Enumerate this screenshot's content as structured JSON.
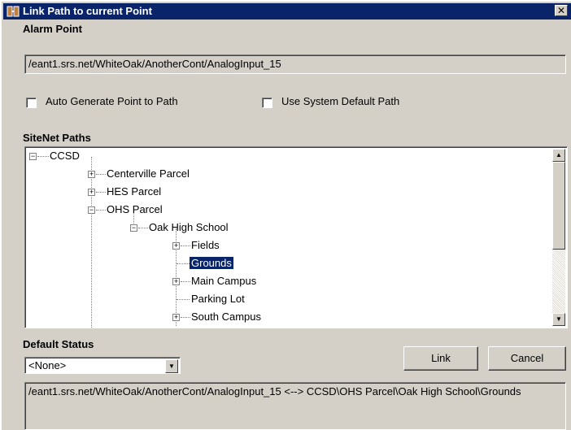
{
  "window": {
    "title": "Link Path to current Point",
    "close_glyph": "✕"
  },
  "alarm_point": {
    "label": "Alarm Point",
    "value": "/eant1.srs.net/WhiteOak/AnotherCont/AnalogInput_15"
  },
  "options": {
    "auto_generate": {
      "label": "Auto Generate Point to Path",
      "checked": false
    },
    "use_default": {
      "label": "Use System Default Path",
      "checked": false
    }
  },
  "sitenet": {
    "label": "SiteNet Paths",
    "nodes": [
      {
        "label": "CCSD",
        "expander": "−"
      },
      {
        "label": "Centerville Parcel",
        "expander": "+"
      },
      {
        "label": "HES Parcel",
        "expander": "+"
      },
      {
        "label": "OHS Parcel",
        "expander": "−"
      },
      {
        "label": "Oak High School",
        "expander": "−"
      },
      {
        "label": "Fields",
        "expander": "+"
      },
      {
        "label": "Grounds",
        "expander": "",
        "selected": true
      },
      {
        "label": "Main Campus",
        "expander": "+"
      },
      {
        "label": "Parking Lot",
        "expander": ""
      },
      {
        "label": "South Campus",
        "expander": "+"
      }
    ]
  },
  "default_status": {
    "label": "Default Status",
    "selected": "<None>"
  },
  "buttons": {
    "link": "Link",
    "cancel": "Cancel"
  },
  "result": {
    "text": "/eant1.srs.net/WhiteOak/AnotherCont/AnalogInput_15 <--> CCSD\\OHS Parcel\\Oak High School\\Grounds"
  }
}
